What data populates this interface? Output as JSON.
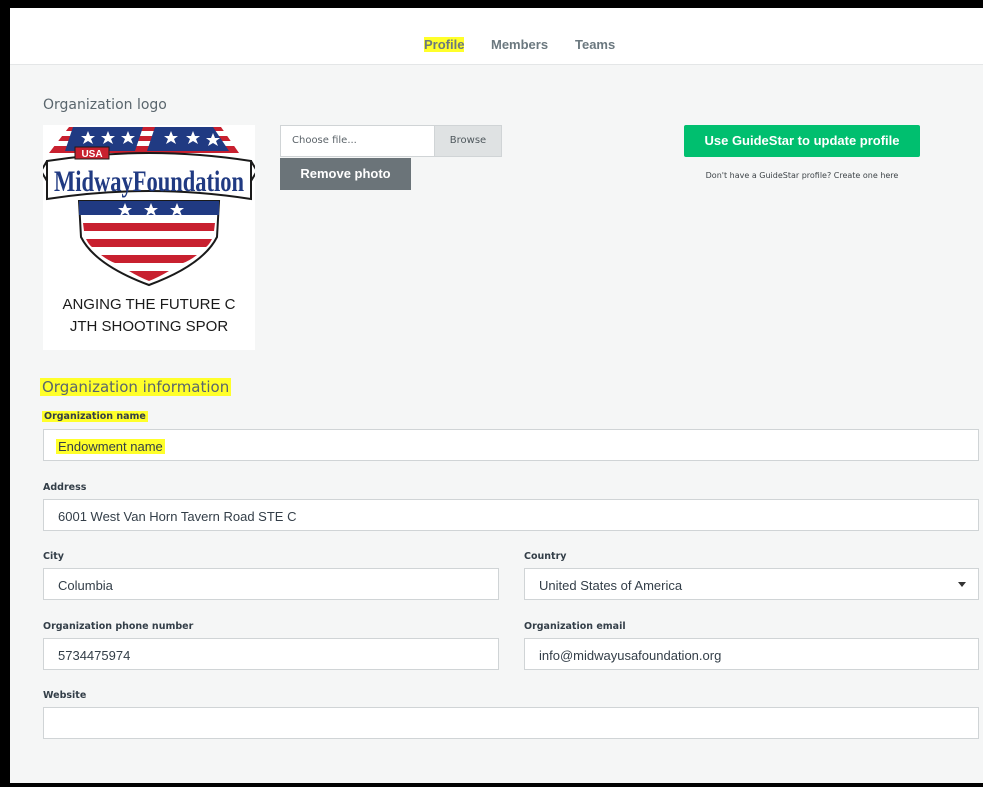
{
  "nav": {
    "tabs": [
      {
        "label": "Profile",
        "active": true
      },
      {
        "label": "Members",
        "active": false
      },
      {
        "label": "Teams",
        "active": false
      }
    ]
  },
  "logo_section": {
    "title": "Organization logo",
    "logo_text": {
      "usa": "USA",
      "brand": "MidwayFoundation",
      "tagline_1": "ANGING THE FUTURE C",
      "tagline_2": "JTH SHOOTING SPOR"
    },
    "file_input": {
      "placeholder": "Choose file...",
      "browse_label": "Browse"
    },
    "remove_photo_label": "Remove photo",
    "guidestar_button_label": "Use GuideStar to update profile",
    "guidestar_note": "Don't have a GuideStar profile? Create one here"
  },
  "info_section": {
    "title": "Organization information",
    "org_name": {
      "label": "Organization name",
      "value": "Endowment name"
    },
    "address": {
      "label": "Address",
      "value": "6001 West Van Horn Tavern Road STE C"
    },
    "city": {
      "label": "City",
      "value": "Columbia"
    },
    "country": {
      "label": "Country",
      "value": "United States of America"
    },
    "phone": {
      "label": "Organization phone number",
      "value": "5734475974"
    },
    "email": {
      "label": "Organization email",
      "value": "info@midwayusafoundation.org"
    },
    "website": {
      "label": "Website",
      "value": ""
    }
  },
  "colors": {
    "highlight": "#ffff2a",
    "primary_green": "#00bf6f",
    "secondary_gray": "#6b7479"
  }
}
